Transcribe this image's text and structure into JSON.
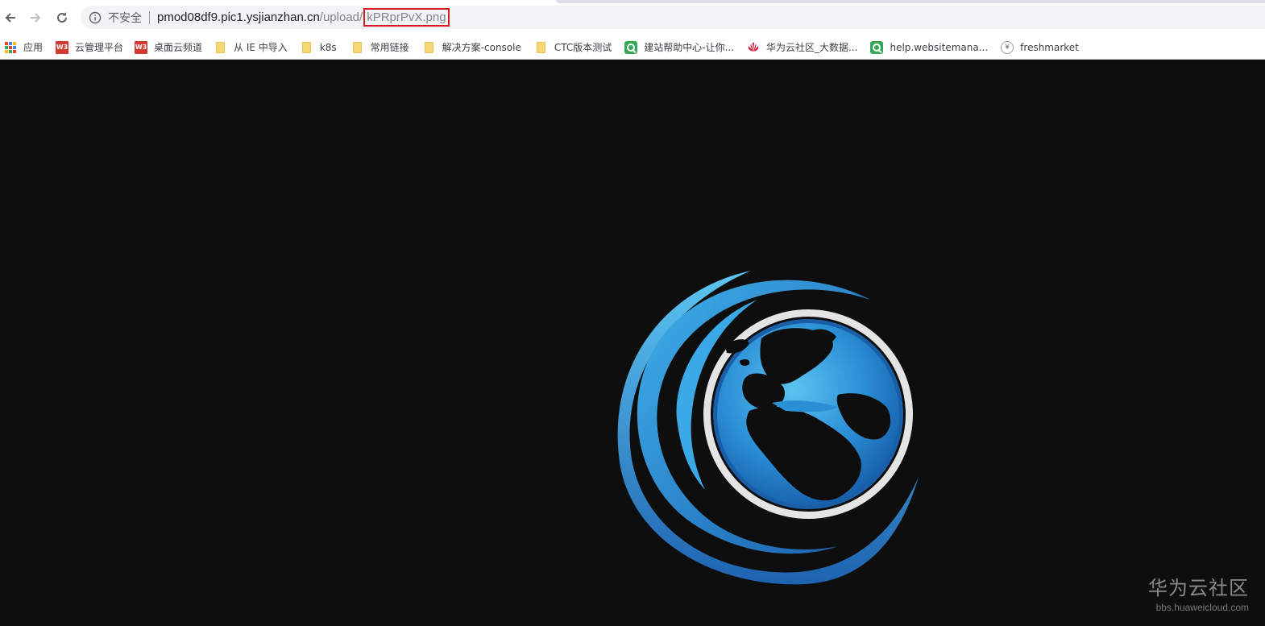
{
  "toolbar": {
    "back_icon": "arrow-left-icon",
    "forward_icon": "arrow-right-icon",
    "reload_icon": "reload-icon",
    "security_label": "不安全",
    "url_host": "pmod08df9.pic1.ysjianzhan.cn",
    "url_path": "/upload/",
    "url_file": "kPRprPvX.png",
    "highlight_color": "#d71920"
  },
  "bookmarks": [
    {
      "label": "应用",
      "icon": "apps-icon"
    },
    {
      "label": "云管理平台",
      "icon": "w3-icon"
    },
    {
      "label": "桌面云频道",
      "icon": "w3-icon"
    },
    {
      "label": "从 IE 中导入",
      "icon": "folder-icon"
    },
    {
      "label": "k8s",
      "icon": "folder-icon"
    },
    {
      "label": "常用链接",
      "icon": "folder-icon"
    },
    {
      "label": "解决方案-console",
      "icon": "folder-icon"
    },
    {
      "label": "CTC版本测试",
      "icon": "folder-icon"
    },
    {
      "label": "建站帮助中心-让你...",
      "icon": "search-icon"
    },
    {
      "label": "华为云社区_大数据...",
      "icon": "huawei-icon"
    },
    {
      "label": "help.websitemana...",
      "icon": "search-icon"
    },
    {
      "label": "freshmarket",
      "icon": "yen-icon"
    }
  ],
  "content": {
    "image_subject": "globe-logo",
    "background_color": "#0e0e0e",
    "accent_blue": "#2b8fd6"
  },
  "watermark": {
    "title": "华为云社区",
    "url": "bbs.huaweicloud.com"
  }
}
